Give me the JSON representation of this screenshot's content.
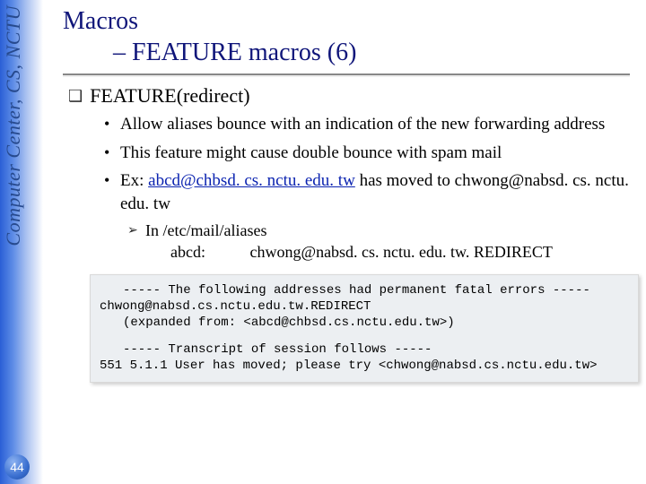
{
  "sidebar": {
    "text": "Computer Center, CS, NCTU"
  },
  "page_number": "44",
  "title": {
    "line1": "Macros",
    "line2": "– FEATURE macros (6)"
  },
  "bullet_main": "FEATURE(redirect)",
  "sub": {
    "item1": "Allow aliases bounce with an indication of the new forwarding address",
    "item2": "This feature might cause double bounce with spam mail",
    "item3_prefix": "Ex: ",
    "item3_link": "abcd@chbsd. cs. nctu. edu. tw",
    "item3_suffix": " has moved to chwong@nabsd. cs. nctu. edu. tw"
  },
  "sub2": {
    "item1": "In /etc/mail/aliases"
  },
  "alias": {
    "key": "abcd:",
    "value": "chwong@nabsd. cs. nctu. edu. tw. REDIRECT"
  },
  "code": {
    "l1": "----- The following addresses had permanent fatal errors -----",
    "l2": "chwong@nabsd.cs.nctu.edu.tw.REDIRECT",
    "l3": "(expanded from: <abcd@chbsd.cs.nctu.edu.tw>)",
    "l4": "----- Transcript of session follows -----",
    "l5": "551 5.1.1 User has moved; please try <chwong@nabsd.cs.nctu.edu.tw>"
  }
}
